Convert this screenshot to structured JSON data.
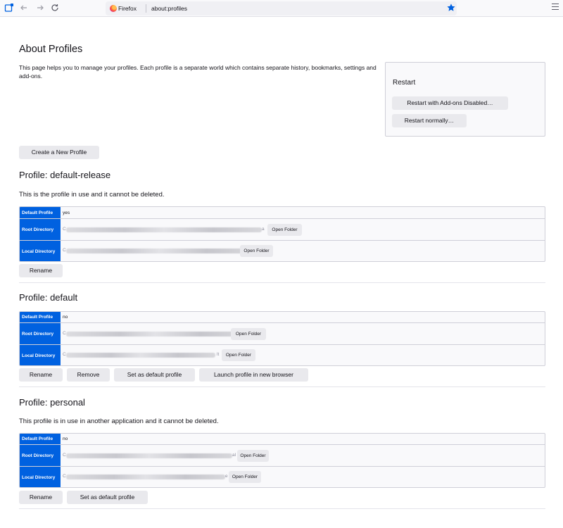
{
  "browser": {
    "identity_label": "Firefox",
    "url": "about:profiles",
    "icons": [
      "sidebar-icon",
      "back-icon",
      "forward-icon",
      "reload-icon",
      "firefox-logo-icon",
      "bookmark-star-icon",
      "app-menu-icon"
    ],
    "accent_color": "#0061e0"
  },
  "page": {
    "title": "About Profiles",
    "intro": "This page helps you to manage your profiles. Each profile is a separate world which contains separate history, bookmarks, settings and add-ons.",
    "create_button": "Create a New Profile"
  },
  "restart": {
    "title": "Restart",
    "addons_disabled_button": "Restart with Add-ons Disabled…",
    "normally_button": "Restart normally…"
  },
  "labels": {
    "default_profile": "Default Profile",
    "root_directory": "Root Directory",
    "local_directory": "Local Directory",
    "open_folder": "Open Folder",
    "rename": "Rename",
    "remove": "Remove",
    "set_default": "Set as default profile",
    "launch": "Launch profile in new browser"
  },
  "profiles": [
    {
      "heading": "Profile: default-release",
      "note": "This is the profile in use and it cannot be deleted.",
      "default_profile": "yes",
      "root_edge_start": "C",
      "root_edge_end": "a",
      "local_edge_start": "C",
      "local_edge_end": "t"
    },
    {
      "heading": "Profile: default",
      "default_profile": "no",
      "root_edge_start": "C",
      "local_edge_start": "C",
      "local_edge_end": "lt"
    },
    {
      "heading": "Profile: personal",
      "note": "This profile is in use in another application and it cannot be deleted.",
      "default_profile": "no",
      "root_edge_start": "C",
      "root_edge_end": "al",
      "local_edge_start": "C",
      "local_edge_end": "e"
    }
  ]
}
